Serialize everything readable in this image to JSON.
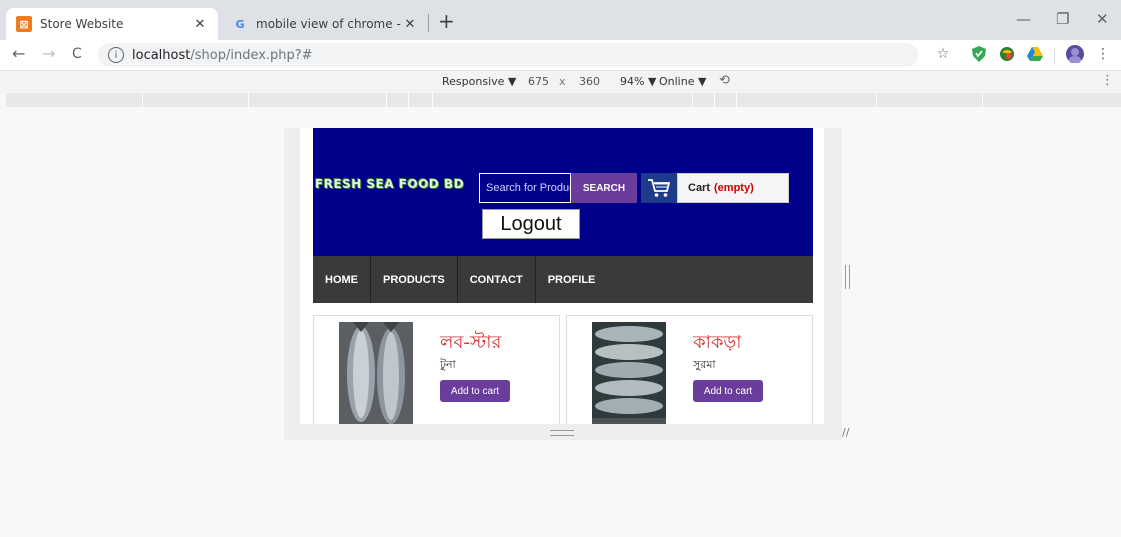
{
  "browser": {
    "tabs": [
      {
        "title": "Store Website",
        "close": "✕"
      },
      {
        "title": "mobile view of chrome - Google",
        "close": "✕"
      }
    ],
    "new_tab": "+",
    "window_controls": {
      "minimize": "—",
      "restore": "❐",
      "close": "✕"
    },
    "nav": {
      "back": "←",
      "forward": "→",
      "reload": "C"
    },
    "url": {
      "host": "localhost",
      "path": "/shop/index.php?#"
    },
    "star": "☆",
    "menu": "⋮"
  },
  "devtools": {
    "device": "Responsive ▼",
    "width": "675",
    "times": "x",
    "height": "360",
    "zoom": "94% ▼",
    "network": "Online ▼",
    "rotate": "⟲",
    "menu": "⋮"
  },
  "site": {
    "logo": "FRESH SEA FOOD BD",
    "search_placeholder": "Search for Product",
    "search_button": "SEARCH",
    "cart_label": "Cart",
    "cart_status": "(empty)",
    "logout": "Logout",
    "nav": [
      "HOME",
      "PRODUCTS",
      "CONTACT",
      "PROFILE"
    ],
    "products": [
      {
        "title": "লব-স্টার",
        "subtitle": "টুনা",
        "button": "Add to cart"
      },
      {
        "title": "কাকড়া",
        "subtitle": "সুরমা",
        "button": "Add to cart"
      }
    ]
  },
  "colors": {
    "header_bg": "#00008b",
    "nav_bg": "#3a3a3a",
    "accent_purple": "#6a3c9c",
    "product_title": "#d32f2f"
  }
}
